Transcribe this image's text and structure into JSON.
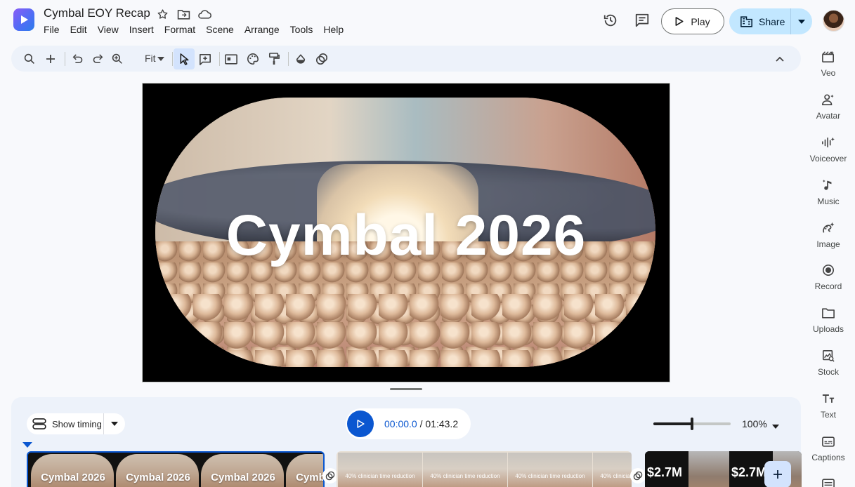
{
  "header": {
    "doc_title": "Cymbal EOY Recap",
    "menu": [
      "File",
      "Edit",
      "View",
      "Insert",
      "Format",
      "Scene",
      "Arrange",
      "Tools",
      "Help"
    ],
    "play_label": "Play",
    "share_label": "Share"
  },
  "toolbar": {
    "zoom_label": "Fit"
  },
  "slide": {
    "title": "Cymbal 2026"
  },
  "rail": [
    {
      "label": "Veo",
      "icon": "veo-icon"
    },
    {
      "label": "Avatar",
      "icon": "avatar-icon"
    },
    {
      "label": "Voiceover",
      "icon": "voiceover-icon"
    },
    {
      "label": "Music",
      "icon": "music-icon"
    },
    {
      "label": "Image",
      "icon": "image-icon"
    },
    {
      "label": "Record",
      "icon": "record-icon"
    },
    {
      "label": "Uploads",
      "icon": "uploads-icon"
    },
    {
      "label": "Stock",
      "icon": "stock-icon"
    },
    {
      "label": "Text",
      "icon": "text-icon"
    },
    {
      "label": "Captions",
      "icon": "captions-icon"
    }
  ],
  "timeline": {
    "show_timing_label": "Show timing",
    "current_time": "00:00.0",
    "separator": "/",
    "total_time": "01:43.2",
    "zoom_percent": "100%",
    "zoom_value": 0.5,
    "clips": [
      {
        "thumb_text": "Cymbal 2026"
      },
      {
        "thumb_text": "40% clinician time reduction"
      },
      {
        "thumb_text": "$2.7M"
      }
    ]
  },
  "colors": {
    "accent": "#0b57d0",
    "share_bg": "#c2e7ff",
    "toolbar_bg": "#edf2fa"
  }
}
